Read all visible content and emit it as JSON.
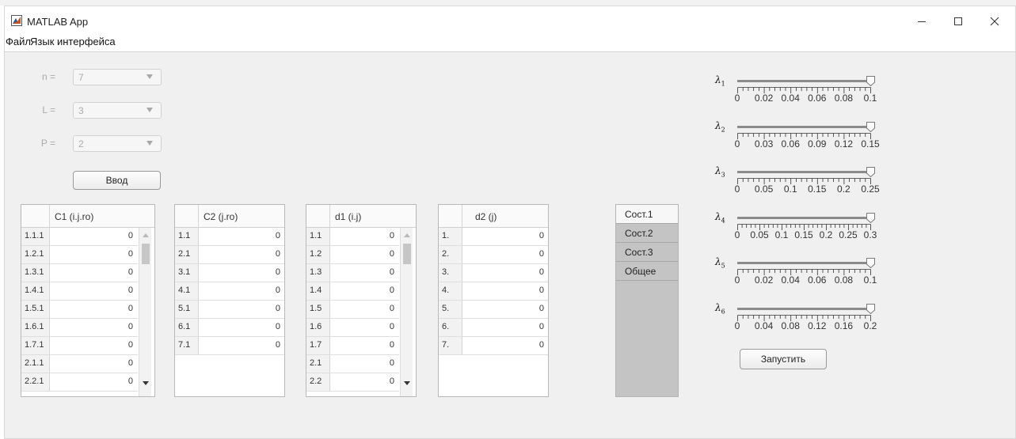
{
  "window": {
    "title": "MATLAB App",
    "controls": [
      "minimize-icon",
      "maximize-icon",
      "close-icon"
    ]
  },
  "menu": [
    "Файл",
    "Язык интерфейса"
  ],
  "params": [
    {
      "label": "n =",
      "value": "7"
    },
    {
      "label": "L =",
      "value": "3"
    },
    {
      "label": "P =",
      "value": "2"
    }
  ],
  "input_button": "Ввод",
  "run_button": "Запустить",
  "tables": [
    {
      "header": "C1 (i.j.ro)",
      "scrollbar": true,
      "rows": [
        {
          "label": "1.1.1",
          "value": "0"
        },
        {
          "label": "1.2.1",
          "value": "0"
        },
        {
          "label": "1.3.1",
          "value": "0"
        },
        {
          "label": "1.4.1",
          "value": "0"
        },
        {
          "label": "1.5.1",
          "value": "0"
        },
        {
          "label": "1.6.1",
          "value": "0"
        },
        {
          "label": "1.7.1",
          "value": "0"
        },
        {
          "label": "2.1.1",
          "value": "0"
        },
        {
          "label": "2.2.1",
          "value": "0"
        }
      ]
    },
    {
      "header": "C2 (j.ro)",
      "scrollbar": false,
      "rows": [
        {
          "label": "1.1",
          "value": "0"
        },
        {
          "label": "2.1",
          "value": "0"
        },
        {
          "label": "3.1",
          "value": "0"
        },
        {
          "label": "4.1",
          "value": "0"
        },
        {
          "label": "5.1",
          "value": "0"
        },
        {
          "label": "6.1",
          "value": "0"
        },
        {
          "label": "7.1",
          "value": "0"
        }
      ]
    },
    {
      "header": "d1 (i.j)",
      "scrollbar": true,
      "rows": [
        {
          "label": "1.1",
          "value": "0"
        },
        {
          "label": "1.2",
          "value": "0"
        },
        {
          "label": "1.3",
          "value": "0"
        },
        {
          "label": "1.4",
          "value": "0"
        },
        {
          "label": "1.5",
          "value": "0"
        },
        {
          "label": "1.6",
          "value": "0"
        },
        {
          "label": "1.7",
          "value": "0"
        },
        {
          "label": "2.1",
          "value": "0"
        },
        {
          "label": "2.2",
          "value": "0"
        }
      ]
    },
    {
      "header": "d2 (j)",
      "scrollbar": false,
      "rows": [
        {
          "label": "1.",
          "value": "0"
        },
        {
          "label": "2.",
          "value": "0"
        },
        {
          "label": "3.",
          "value": "0"
        },
        {
          "label": "4.",
          "value": "0"
        },
        {
          "label": "5.",
          "value": "0"
        },
        {
          "label": "6.",
          "value": "0"
        },
        {
          "label": "7.",
          "value": "0"
        }
      ]
    }
  ],
  "tabs": [
    "Сост.1",
    "Сост.2",
    "Сост.3",
    "Общее"
  ],
  "selected_tab": 0,
  "sliders": [
    {
      "symbol": "λ",
      "index": "1",
      "min": 0,
      "max": 0.1,
      "value": 0.1,
      "tick_labels": [
        "0",
        "0.02",
        "0.04",
        "0.06",
        "0.08",
        "0.1"
      ]
    },
    {
      "symbol": "λ",
      "index": "2",
      "min": 0,
      "max": 0.15,
      "value": 0.15,
      "tick_labels": [
        "0",
        "0.03",
        "0.06",
        "0.09",
        "0.12",
        "0.15"
      ]
    },
    {
      "symbol": "λ",
      "index": "3",
      "min": 0,
      "max": 0.25,
      "value": 0.25,
      "tick_labels": [
        "0",
        "0.05",
        "0.1",
        "0.15",
        "0.2",
        "0.25"
      ]
    },
    {
      "symbol": "λ",
      "index": "4",
      "min": 0,
      "max": 0.3,
      "value": 0.3,
      "tick_labels": [
        "0",
        "0.05",
        "0.1",
        "0.15",
        "0.2",
        "0.25",
        "0.3"
      ]
    },
    {
      "symbol": "λ",
      "index": "5",
      "min": 0,
      "max": 0.1,
      "value": 0.1,
      "tick_labels": [
        "0",
        "0.02",
        "0.04",
        "0.06",
        "0.08",
        "0.1"
      ]
    },
    {
      "symbol": "λ",
      "index": "6",
      "min": 0,
      "max": 0.2,
      "value": 0.2,
      "tick_labels": [
        "0",
        "0.04",
        "0.08",
        "0.12",
        "0.16",
        "0.2"
      ]
    }
  ],
  "colors": {
    "panel_bg": "#f0f0f0",
    "tab_bg": "#c4c4c4",
    "slider_track": "#8b8b8b"
  }
}
